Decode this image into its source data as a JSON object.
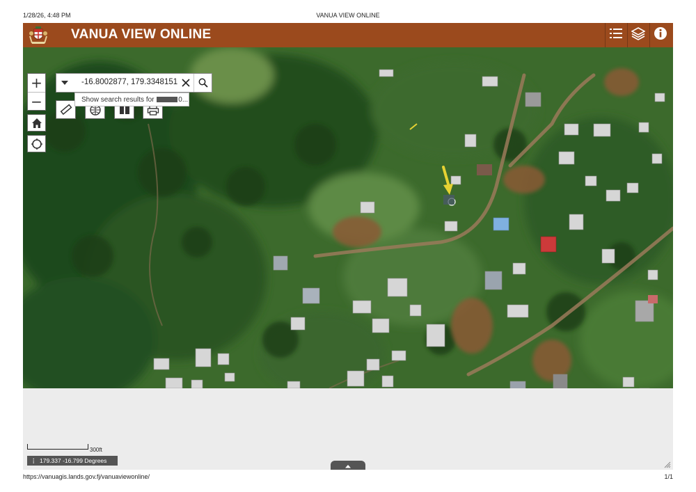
{
  "print_header": {
    "timestamp": "1/28/26, 4:48 PM",
    "title": "VANUA VIEW ONLINE"
  },
  "print_footer": {
    "url": "https://vanuagis.lands.gov.fj/vanuaviewonline/",
    "page": "1/1"
  },
  "app": {
    "title": "VANUA VIEW ONLINE",
    "banner_color": "#9b4a1d",
    "banner_icons": [
      "list-icon",
      "layers-icon",
      "info-icon"
    ]
  },
  "search": {
    "value": "-16.8002877, 179.3348151",
    "suggestion_prefix": "Show search results for",
    "suggestion_suffix": "0..."
  },
  "map_controls": {
    "zoom_in": "+",
    "zoom_out": "−",
    "icons": [
      "home-icon",
      "locate-icon",
      "measure-icon",
      "bookmark-icon",
      "compare-icon",
      "print-icon"
    ]
  },
  "status": {
    "scale": "300ft",
    "coordinates": "179.337 -16.799 Degrees"
  }
}
